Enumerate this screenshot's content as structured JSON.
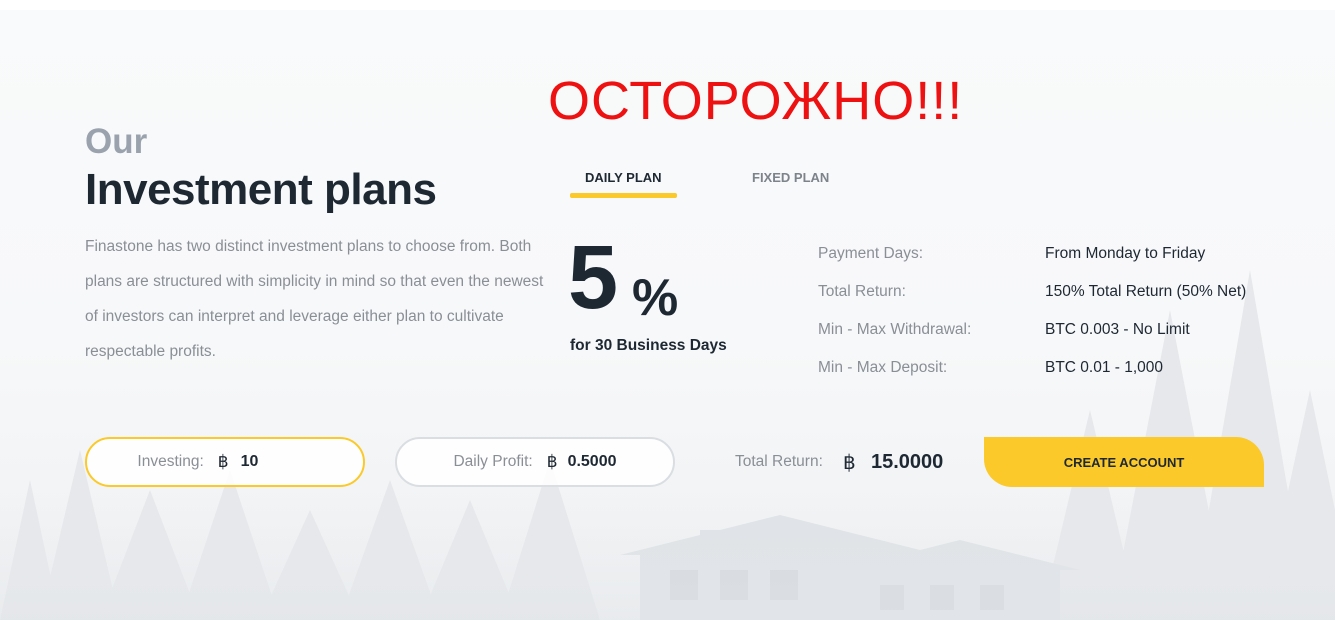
{
  "warning": "ОСТОРОЖНО!!!",
  "heading": {
    "our": "Our",
    "title": "Investment plans"
  },
  "description": "Finastone has two distinct investment plans to choose from. Both plans are structured with simplicity in mind so that even the newest of investors can interpret and leverage either plan to cultivate respectable profits.",
  "tabs": {
    "daily": "DAILY PLAN",
    "fixed": "FIXED PLAN",
    "active": "daily"
  },
  "plan": {
    "rate": "5",
    "percent_sign": "%",
    "duration": "for 30 Business Days"
  },
  "details": [
    {
      "label": "Payment Days:",
      "value": "From Monday to Friday"
    },
    {
      "label": "Total Return:",
      "value": "150% Total Return (50% Net)"
    },
    {
      "label": "Min - Max Withdrawal:",
      "value": "BTC 0.003 - No Limit"
    },
    {
      "label": "Min - Max Deposit:",
      "value": "BTC 0.01 - 1,000"
    }
  ],
  "calculator": {
    "investing_label": "Investing:",
    "btc_symbol": "฿",
    "investing_value": "10",
    "daily_profit_label": "Daily Profit:",
    "daily_profit_value": "0.5000",
    "total_return_label": "Total Return:",
    "total_return_value": "15.0000"
  },
  "cta": {
    "label": "CREATE ACCOUNT"
  },
  "colors": {
    "accent": "#fbc92a",
    "dark": "#1e2833",
    "muted": "#8a8f96",
    "warning": "#ee1111"
  }
}
